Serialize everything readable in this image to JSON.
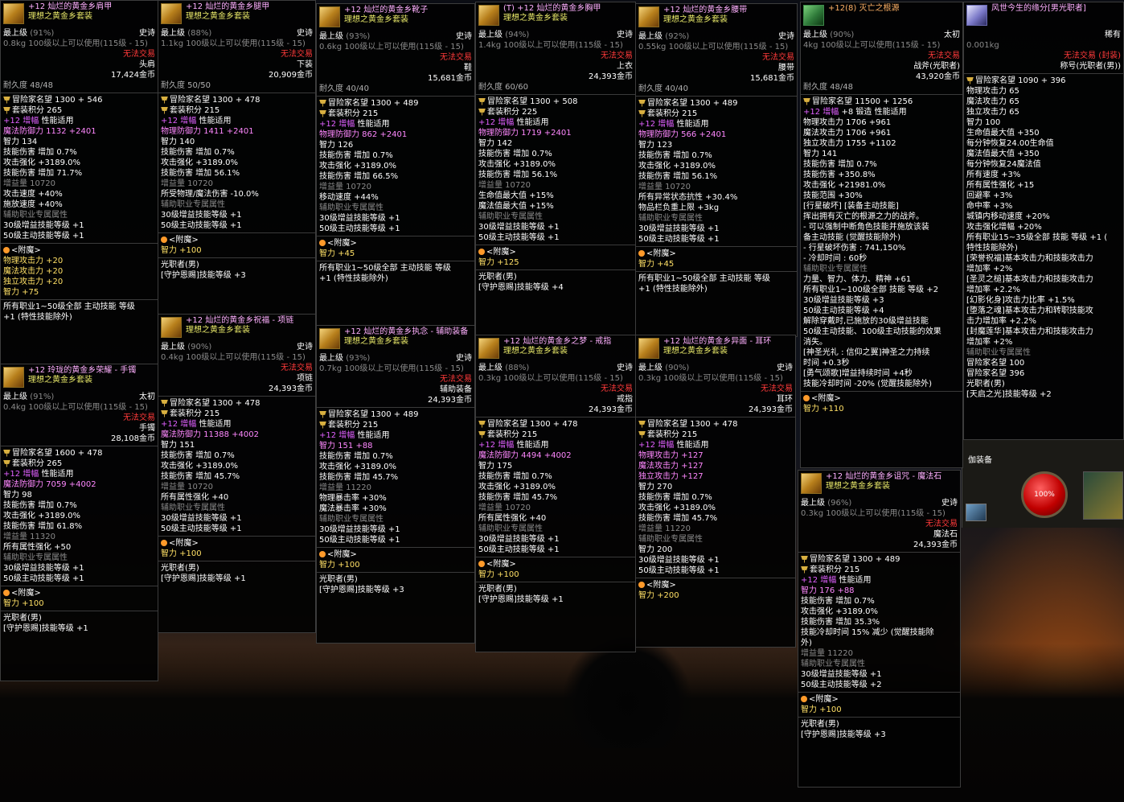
{
  "hud": {
    "hp_label": "100%",
    "equip_label": "伽装备"
  },
  "panels": [
    {
      "title": "+12 灿烂的黄金乡肩甲",
      "set": "理想之黄金乡套装",
      "grade": "最上级",
      "pct": "(91%)",
      "rarity": "史诗",
      "weight": "0.8kg",
      "req": "100级以上可以使用(115级 - 15)",
      "trade": "无法交易",
      "slot": "头肩",
      "price": "17,424金币",
      "dura": "耐久度 48/48",
      "fame": "冒险家名望 1300 + 546",
      "setpt": "套装积分 265",
      "amp": "+12 增幅",
      "ampsub": "性能适用",
      "lines": [
        "魔法防御力 1132 +2401",
        "智力 134",
        "技能伤害 增加 0.7%",
        "攻击强化 +3189.0%",
        "技能伤害 增加 71.7%",
        "增益量 10720",
        "攻击速度 +40%",
        "施放速度 +40%",
        "辅助职业专属属性",
        "30级增益技能等级 +1",
        "50级主动技能等级 +1"
      ],
      "enchant": "<附魔>",
      "ench": [
        "物理攻击力 +20",
        "魔法攻击力 +20",
        "独立攻击力 +20",
        "智力 +75"
      ],
      "tail": [
        "所有职业1~50级全部 主动技能 等级",
        "+1 (特性技能除外)"
      ]
    },
    {
      "title": "+12 灿烂的黄金乡腿甲",
      "set": "理想之黄金乡套装",
      "grade": "最上级",
      "pct": "(88%)",
      "rarity": "史诗",
      "weight": "1.1kg",
      "req": "100级以上可以使用(115级 - 15)",
      "trade": "无法交易",
      "slot": "下装",
      "price": "20,909金币",
      "dura": "耐久度 50/50",
      "fame": "冒险家名望 1300 + 478",
      "setpt": "套装积分 215",
      "amp": "+12 增幅",
      "ampsub": "性能适用",
      "lines": [
        "物理防御力 1411 +2401",
        "智力 140",
        "技能伤害 增加 0.7%",
        "攻击强化 +3189.0%",
        "技能伤害 增加 56.1%",
        "增益量 10720",
        "所受物理/魔法伤害 -10.0%",
        "辅助职业专属属性",
        "30级增益技能等级 +1",
        "50级主动技能等级 +1"
      ],
      "enchant": "<附魔>",
      "ench": [
        "智力 +100"
      ],
      "tail": [
        "光职者(男)",
        "[守护恩赐]技能等级 +3"
      ]
    },
    {
      "title": "+12 灿烂的黄金乡靴子",
      "set": "理想之黄金乡套装",
      "grade": "最上级",
      "pct": "(93%)",
      "rarity": "史诗",
      "weight": "0.6kg",
      "req": "100级以上可以使用(115级 - 15)",
      "trade": "无法交易",
      "slot": "鞋",
      "price": "15,681金币",
      "dura": "耐久度 40/40",
      "fame": "冒险家名望 1300 + 489",
      "setpt": "套装积分 215",
      "amp": "+12 增幅",
      "ampsub": "性能适用",
      "lines": [
        "物理防御力 862 +2401",
        "智力 126",
        "技能伤害 增加 0.7%",
        "攻击强化 +3189.0%",
        "技能伤害 增加 66.5%",
        "增益量 10720",
        "移动速度 +44%",
        "辅助职业专属属性",
        "30级增益技能等级 +1",
        "50级主动技能等级 +1"
      ],
      "enchant": "<附魔>",
      "ench": [
        "智力 +45"
      ],
      "tail": [
        "所有职业1~50级全部 主动技能 等级",
        "+1 (特性技能除外)"
      ]
    },
    {
      "title": "(T) +12 灿烂的黄金乡胸甲",
      "set": "理想之黄金乡套装",
      "grade": "最上级",
      "pct": "(94%)",
      "rarity": "史诗",
      "weight": "1.4kg",
      "req": "100级以上可以使用(115级 - 15)",
      "trade": "无法交易",
      "slot": "上衣",
      "price": "24,393金币",
      "dura": "耐久度 60/60",
      "fame": "冒险家名望 1300 + 508",
      "setpt": "套装积分 225",
      "amp": "+12 增幅",
      "ampsub": "性能适用",
      "lines": [
        "物理防御力 1719 +2401",
        "智力 142",
        "技能伤害 增加 0.7%",
        "攻击强化 +3189.0%",
        "技能伤害 增加 56.1%",
        "增益量 10720",
        "生命值最大值 +15%",
        "魔法值最大值 +15%",
        "辅助职业专属属性",
        "30级增益技能等级 +1",
        "50级主动技能等级 +1"
      ],
      "enchant": "<附魔>",
      "ench": [
        "智力 +125"
      ],
      "tail": [
        "光职者(男)",
        "[守护恩赐]技能等级 +4"
      ]
    },
    {
      "title": "+12 灿烂的黄金乡腰带",
      "set": "理想之黄金乡套装",
      "grade": "最上级",
      "pct": "(92%)",
      "rarity": "史诗",
      "weight": "0.55kg",
      "req": "100级以上可以使用(115级 - 15)",
      "trade": "无法交易",
      "slot": "腰带",
      "price": "15,681金币",
      "dura": "耐久度 40/40",
      "fame": "冒险家名望 1300 + 489",
      "setpt": "套装积分 215",
      "amp": "+12 增幅",
      "ampsub": "性能适用",
      "lines": [
        "物理防御力 566 +2401",
        "智力 123",
        "技能伤害 增加 0.7%",
        "攻击强化 +3189.0%",
        "技能伤害 增加 56.1%",
        "增益量 10720",
        "所有异常状态抗性 +30.4%",
        "物品栏负重上限 +3kg",
        "辅助职业专属属性",
        "30级增益技能等级 +1",
        "50级主动技能等级 +1"
      ],
      "enchant": "<附魔>",
      "ench": [
        "智力 +45"
      ],
      "tail": [
        "所有职业1~50级全部 主动技能 等级",
        "+1 (特性技能除外)"
      ]
    },
    {
      "title": "+12(8) 灭亡之根源",
      "set": "",
      "grade": "最上级",
      "pct": "(90%)",
      "rarity": "太初",
      "weight": "4kg",
      "req": "100级以上可以使用(115级 - 15)",
      "trade": "无法交易",
      "slot": "战斧(光职者)",
      "price": "43,920金币",
      "dura": "耐久度 48/48",
      "fame": "冒险家名望 11500 + 1256",
      "setpt": "",
      "amp": "+12 增幅",
      "ampsub": "+8 锻造 性能适用",
      "lines": [
        "物理攻击力 1706 +961",
        "魔法攻击力 1706 +961",
        "独立攻击力 1755 +1102",
        "智力 141",
        "技能伤害 增加 0.7%",
        "技能伤害 +350.8%",
        "攻击强化 +21981.0%",
        "技能范围 +30%",
        "[行星破坏] [装备主动技能]",
        "挥出拥有灭亡的根源之力的战斧。",
        "- 可以强制中断角色技能并施放该装",
        "备主动技能 (觉醒技能除外)",
        "- 行星破坏伤害 : 741,150%",
        "- 冷却时间 : 60秒",
        "辅助职业专属属性",
        "力量、智力、体力、精神 +61",
        "所有职业1~100级全部 技能 等级 +2",
        "30级增益技能等级 +3",
        "50级主动技能等级 +4",
        "解除穿戴时,已施放的30级增益技能",
        "50级主动技能、100级主动技能的效果",
        "消失。",
        "[神圣光礼 : 信仰之翼]神圣之力持续",
        "时间 +0.3秒",
        "[勇气颂歌]增益持续时间 +4秒",
        "技能冷却时间 -20% (觉醒技能除外)"
      ],
      "enchant": "<附魔>",
      "ench": [
        "智力 +110"
      ],
      "tail": []
    },
    {
      "title": "风世今生的缘分[男光职者]",
      "set": "",
      "grade": "",
      "pct": "",
      "rarity": "稀有",
      "weight": "0.001kg",
      "req": "",
      "trade": "无法交易 (封装)",
      "slot": "称号(光职者(男))",
      "price": "",
      "dura": "",
      "fame": "冒险家名望 1090 + 396",
      "setpt": "",
      "amp": "",
      "ampsub": "",
      "lines": [
        "物理攻击力 65",
        "魔法攻击力 65",
        "独立攻击力 65",
        "智力 100",
        "生命值最大值 +350",
        "每分钟恢复24.00生命值",
        "魔法值最大值 +350",
        "每分钟恢复24魔法值",
        "所有速度 +3%",
        "所有属性强化 +15",
        "回避率 +3%",
        "命中率 +3%",
        "城镇内移动速度 +20%",
        "攻击强化增幅 +20%",
        "所有职业15~35级全部 技能 等级 +1 (",
        "特性技能除外)",
        "[荣誉祝福]基本攻击力和技能攻击力",
        "增加率 +2%",
        "[圣灵之槌]基本攻击力和技能攻击力",
        "增加率 +2.2%",
        "[幻影化身]攻击力比率 +1.5%",
        "[堕落之魂]基本攻击力和转职技能攻",
        "击力增加率 +2.2%",
        "[封魔莲华]基本攻击力和技能攻击力",
        "增加率 +2%",
        "辅助职业专属属性",
        "冒险家名望 100",
        "冒险家名望 396",
        "光职者(男)",
        "[天启之光]技能等级 +2"
      ],
      "enchant": "",
      "ench": [],
      "tail": []
    },
    {
      "title": "+12 玲珑的黄金乡荣耀 - 手镯",
      "set": "理想之黄金乡套装",
      "grade": "最上级",
      "pct": "(91%)",
      "rarity": "太初",
      "weight": "0.4kg",
      "req": "100级以上可以使用(115级 - 15)",
      "trade": "无法交易",
      "slot": "手镯",
      "price": "28,108金币",
      "dura": "",
      "fame": "冒险家名望 1600 + 478",
      "setpt": "套装积分 265",
      "amp": "+12 增幅",
      "ampsub": "性能适用",
      "lines": [
        "魔法防御力 7059 +4002",
        "智力 98",
        "技能伤害 增加 0.7%",
        "攻击强化 +3189.0%",
        "技能伤害 增加 61.8%",
        "增益量 11320",
        "所有属性强化 +50",
        "辅助职业专属属性",
        "30级增益技能等级 +1",
        "50级主动技能等级 +1"
      ],
      "enchant": "<附魔>",
      "ench": [
        "智力 +100"
      ],
      "tail": [
        "光职者(男)",
        "[守护恩赐]技能等级 +1"
      ]
    },
    {
      "title": "+12 灿烂的黄金乡祝福 - 项链",
      "set": "理想之黄金乡套装",
      "grade": "最上级",
      "pct": "(90%)",
      "rarity": "史诗",
      "weight": "0.4kg",
      "req": "100级以上可以使用(115级 - 15)",
      "trade": "无法交易",
      "slot": "项链",
      "price": "24,393金币",
      "dura": "",
      "fame": "冒险家名望 1300 + 478",
      "setpt": "套装积分 215",
      "amp": "+12 增幅",
      "ampsub": "性能适用",
      "lines": [
        "魔法防御力 11388 +4002",
        "智力 151",
        "技能伤害 增加 0.7%",
        "攻击强化 +3189.0%",
        "技能伤害 增加 45.7%",
        "增益量 10720",
        "所有属性强化 +40",
        "辅助职业专属属性",
        "30级增益技能等级 +1",
        "50级主动技能等级 +1"
      ],
      "enchant": "<附魔>",
      "ench": [
        "智力 +100"
      ],
      "tail": [
        "光职者(男)",
        "[守护恩赐]技能等级 +1"
      ]
    },
    {
      "title": "+12 灿烂的黄金乡执念 - 辅助装备",
      "set": "理想之黄金乡套装",
      "grade": "最上级",
      "pct": "(93%)",
      "rarity": "史诗",
      "weight": "0.7kg",
      "req": "100级以上可以使用(115级 - 15)",
      "trade": "无法交易",
      "slot": "辅助装备",
      "price": "24,393金币",
      "dura": "",
      "fame": "冒险家名望 1300 + 489",
      "setpt": "套装积分 215",
      "amp": "+12 增幅",
      "ampsub": "性能适用",
      "lines": [
        "智力 151 +88",
        "技能伤害 增加 0.7%",
        "攻击强化 +3189.0%",
        "技能伤害 增加 45.7%",
        "增益量 11220",
        "物理暴击率 +30%",
        "魔法暴击率 +30%",
        "辅助职业专属属性",
        "30级增益技能等级 +1",
        "50级主动技能等级 +1"
      ],
      "enchant": "<附魔>",
      "ench": [
        "智力 +100"
      ],
      "tail": [
        "光职者(男)",
        "[守护恩赐]技能等级 +3"
      ]
    },
    {
      "title": "+12 灿烂的黄金乡之梦 - 戒指",
      "set": "理想之黄金乡套装",
      "grade": "最上级",
      "pct": "(88%)",
      "rarity": "史诗",
      "weight": "0.3kg",
      "req": "100级以上可以使用(115级 - 15)",
      "trade": "无法交易",
      "slot": "戒指",
      "price": "24,393金币",
      "dura": "",
      "fame": "冒险家名望 1300 + 478",
      "setpt": "套装积分 215",
      "amp": "+12 增幅",
      "ampsub": "性能适用",
      "lines": [
        "魔法防御力 4494 +4002",
        "智力 175",
        "技能伤害 增加 0.7%",
        "攻击强化 +3189.0%",
        "技能伤害 增加 45.7%",
        "增益量 10720",
        "所有属性强化 +40",
        "辅助职业专属属性",
        "30级增益技能等级 +1",
        "50级主动技能等级 +1"
      ],
      "enchant": "<附魔>",
      "ench": [
        "智力 +100"
      ],
      "tail": [
        "光职者(男)",
        "[守护恩赐]技能等级 +1"
      ]
    },
    {
      "title": "+12 灿烂的黄金乡异面 - 耳环",
      "set": "理想之黄金乡套装",
      "grade": "最上级",
      "pct": "(90%)",
      "rarity": "史诗",
      "weight": "0.3kg",
      "req": "100级以上可以使用(115级 - 15)",
      "trade": "无法交易",
      "slot": "耳环",
      "price": "24,393金币",
      "dura": "",
      "fame": "冒险家名望 1300 + 478",
      "setpt": "套装积分 215",
      "amp": "+12 增幅",
      "ampsub": "性能适用",
      "lines": [
        "物理攻击力 +127",
        "魔法攻击力 +127",
        "独立攻击力 +127",
        "智力 270",
        "技能伤害 增加 0.7%",
        "攻击强化 +3189.0%",
        "技能伤害 增加 45.7%",
        "增益量 11220",
        "辅助职业专属属性",
        "智力 200",
        "30级增益技能等级 +1",
        "50级主动技能等级 +1"
      ],
      "enchant": "<附魔>",
      "ench": [
        "智力 +200"
      ],
      "tail": []
    },
    {
      "title": "+12 灿烂的黄金乡诅咒 - 魔法石",
      "set": "理想之黄金乡套装",
      "grade": "最上级",
      "pct": "(96%)",
      "rarity": "史诗",
      "weight": "0.3kg",
      "req": "100级以上可以使用(115级 - 15)",
      "trade": "无法交易",
      "slot": "魔法石",
      "price": "24,393金币",
      "dura": "",
      "fame": "冒险家名望 1300 + 489",
      "setpt": "套装积分 215",
      "amp": "+12 增幅",
      "ampsub": "性能适用",
      "lines": [
        "智力 176 +88",
        "技能伤害 增加 0.7%",
        "攻击强化 +3189.0%",
        "技能伤害 增加 35.3%",
        "技能冷却时间 15% 减少 (觉醒技能除",
        "外)",
        "增益量 11220",
        "辅助职业专属属性",
        "30级增益技能等级 +1",
        "50级主动技能等级 +2"
      ],
      "enchant": "<附魔>",
      "ench": [
        "智力 +100"
      ],
      "tail": [
        "光职者(男)",
        "[守护恩赐]技能等级 +3"
      ]
    }
  ]
}
